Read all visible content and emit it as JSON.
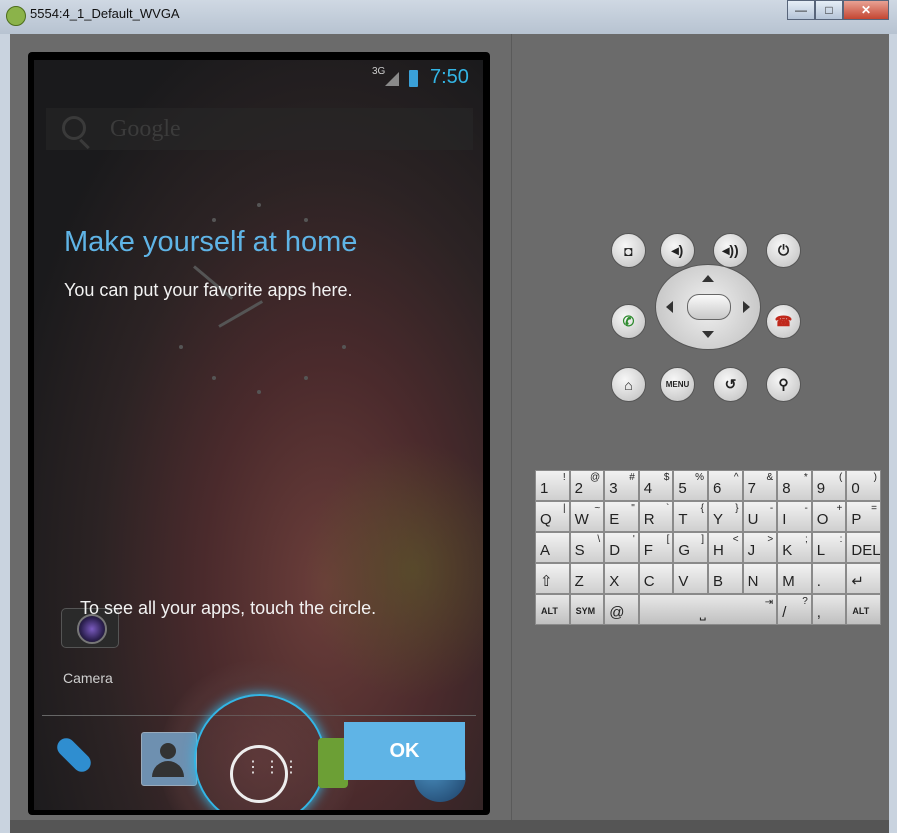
{
  "window": {
    "title": "5554:4_1_Default_WVGA",
    "minimize": "—",
    "maximize": "□",
    "close": "✕"
  },
  "statusbar": {
    "network": "3G",
    "time": "7:50"
  },
  "search": {
    "placeholder": "Google"
  },
  "cling": {
    "title": "Make yourself at home",
    "subtitle": "You can put your favorite apps here.",
    "hint": "To see all your apps, touch the circle.",
    "ok_label": "OK"
  },
  "workspace": {
    "camera_label": "Camera"
  },
  "hotseat": {
    "allapps_glyph": "⋮⋮⋮"
  },
  "controls": {
    "camera": "◘",
    "volume_down": "◂)",
    "volume_up": "◂))",
    "power": "⏻",
    "call": "✆",
    "end_call": "☎",
    "home": "⌂",
    "menu": "MENU",
    "back": "↺",
    "search": "⚲"
  },
  "keyboard": {
    "rows": [
      [
        {
          "k": "1",
          "a": "!"
        },
        {
          "k": "2",
          "a": "@"
        },
        {
          "k": "3",
          "a": "#"
        },
        {
          "k": "4",
          "a": "$"
        },
        {
          "k": "5",
          "a": "%"
        },
        {
          "k": "6",
          "a": "^"
        },
        {
          "k": "7",
          "a": "&"
        },
        {
          "k": "8",
          "a": "*"
        },
        {
          "k": "9",
          "a": "("
        },
        {
          "k": "0",
          "a": ")"
        }
      ],
      [
        {
          "k": "Q",
          "a": "|"
        },
        {
          "k": "W",
          "a": "~"
        },
        {
          "k": "E",
          "a": "\""
        },
        {
          "k": "R",
          "a": "`"
        },
        {
          "k": "T",
          "a": "{"
        },
        {
          "k": "Y",
          "a": "}"
        },
        {
          "k": "U",
          "a": "-"
        },
        {
          "k": "I",
          "a": "-"
        },
        {
          "k": "O",
          "a": "+"
        },
        {
          "k": "P",
          "a": "="
        }
      ],
      [
        {
          "k": "A",
          "a": ""
        },
        {
          "k": "S",
          "a": "\\"
        },
        {
          "k": "D",
          "a": "'"
        },
        {
          "k": "F",
          "a": "["
        },
        {
          "k": "G",
          "a": "]"
        },
        {
          "k": "H",
          "a": "<"
        },
        {
          "k": "J",
          "a": ">"
        },
        {
          "k": "K",
          "a": ";"
        },
        {
          "k": "L",
          "a": ":"
        },
        {
          "k": "DEL",
          "a": ""
        }
      ],
      [
        {
          "k": "⇧",
          "a": ""
        },
        {
          "k": "Z",
          "a": ""
        },
        {
          "k": "X",
          "a": ""
        },
        {
          "k": "C",
          "a": ""
        },
        {
          "k": "V",
          "a": ""
        },
        {
          "k": "B",
          "a": ""
        },
        {
          "k": "N",
          "a": ""
        },
        {
          "k": "M",
          "a": ""
        },
        {
          "k": ".",
          "a": ""
        },
        {
          "k": "↵",
          "a": ""
        }
      ]
    ],
    "bottom": {
      "alt_left": "ALT",
      "sym": "SYM",
      "at": "@",
      "space": "⎵",
      "tab": "⇥",
      "slash": "/",
      "slash_alt": "?",
      "comma": ",",
      "alt_right": "ALT"
    }
  }
}
